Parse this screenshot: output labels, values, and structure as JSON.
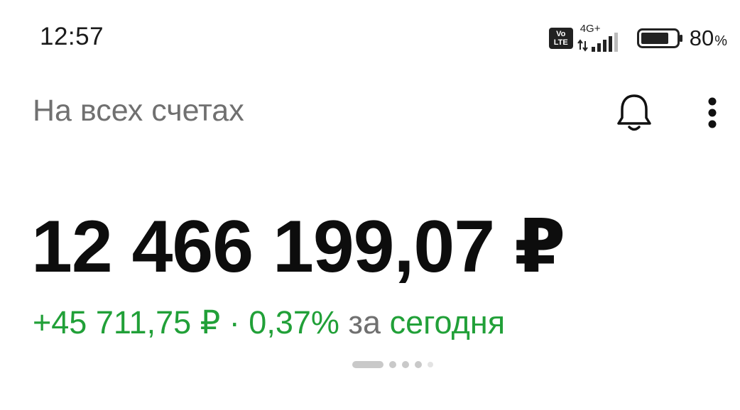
{
  "status_bar": {
    "time": "12:57",
    "volte_top": "Vo",
    "volte_bottom": "LTE",
    "network_type": "4G+",
    "battery_value": "80",
    "battery_unit": "%",
    "battery_level": 0.8
  },
  "header": {
    "title": "На всех счетах",
    "bell_icon": "bell-icon",
    "more_icon": "more-vertical-icon"
  },
  "balance": {
    "amount": "12 466 199,07 ₽",
    "change_amount": "+45 711,75 ₽",
    "separator": "·",
    "change_percent": "0,37%",
    "period_prefix": "за",
    "period": "сегодня"
  },
  "page_indicator": {
    "pages": 5,
    "active_index": 0
  },
  "colors": {
    "positive": "#21a038",
    "muted_text": "#707070",
    "primary_text": "#0d0d0d"
  }
}
